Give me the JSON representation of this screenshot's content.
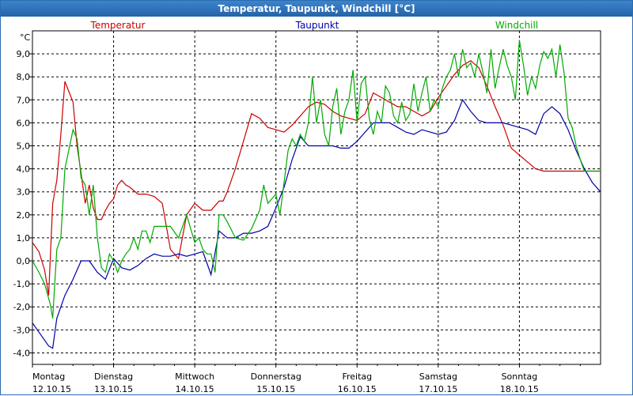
{
  "window": {
    "title": "Temperatur, Taupunkt, Windchill [°C]"
  },
  "chart_data": {
    "type": "line",
    "title": "Temperatur, Taupunkt, Windchill [°C]",
    "ylabel": "°C",
    "ylim": [
      -4.5,
      10.0
    ],
    "yticks": [
      -4,
      -3,
      -2,
      -1,
      0,
      1,
      2,
      3,
      4,
      5,
      6,
      7,
      8,
      9
    ],
    "ytick_labels": [
      "-4,0",
      "-3,0",
      "-2,0",
      "-1,0",
      "0,0",
      "1,0",
      "2,0",
      "3,0",
      "4,0",
      "5,0",
      "6,0",
      "7,0",
      "8,0",
      "9,0"
    ],
    "xlim": [
      0,
      7.0
    ],
    "x_label_days": [
      "Montag",
      "Dienstag",
      "Mittwoch",
      "Donnerstag",
      "Freitag",
      "Samstag",
      "Sonntag"
    ],
    "x_label_dates": [
      "12.10.15",
      "13.10.15",
      "14.10.15",
      "15.10.15",
      "16.10.15",
      "17.10.15",
      "18.10.15"
    ],
    "grid": true,
    "legend_position": "top",
    "series": [
      {
        "name": "Temperatur",
        "color": "#cc0000",
        "x": [
          0.0,
          0.08,
          0.15,
          0.2,
          0.25,
          0.3,
          0.35,
          0.4,
          0.5,
          0.55,
          0.6,
          0.65,
          0.7,
          0.75,
          0.8,
          0.85,
          0.9,
          0.95,
          1.0,
          1.05,
          1.1,
          1.15,
          1.2,
          1.3,
          1.4,
          1.5,
          1.6,
          1.7,
          1.8,
          1.9,
          2.0,
          2.1,
          2.2,
          2.25,
          2.3,
          2.35,
          2.4,
          2.5,
          2.6,
          2.7,
          2.8,
          2.9,
          3.0,
          3.1,
          3.2,
          3.3,
          3.4,
          3.5,
          3.6,
          3.7,
          3.8,
          3.9,
          4.0,
          4.1,
          4.2,
          4.3,
          4.4,
          4.5,
          4.6,
          4.7,
          4.8,
          4.9,
          5.0,
          5.1,
          5.2,
          5.3,
          5.4,
          5.5,
          5.6,
          5.7,
          5.8,
          5.9,
          6.0,
          6.1,
          6.2,
          6.3,
          6.4,
          6.5,
          6.6,
          6.7,
          6.8,
          6.9,
          7.0
        ],
        "values": [
          0.8,
          0.4,
          -0.4,
          -1.5,
          2.5,
          3.5,
          5.5,
          7.8,
          6.9,
          5.0,
          3.8,
          2.5,
          3.3,
          2.3,
          1.8,
          1.8,
          2.2,
          2.5,
          2.7,
          3.3,
          3.5,
          3.3,
          3.2,
          2.9,
          2.9,
          2.8,
          2.5,
          0.5,
          0.1,
          2.0,
          2.5,
          2.2,
          2.2,
          2.4,
          2.6,
          2.6,
          3.0,
          4.0,
          5.2,
          6.4,
          6.2,
          5.8,
          5.7,
          5.6,
          5.9,
          6.3,
          6.7,
          6.9,
          6.8,
          6.5,
          6.3,
          6.2,
          6.1,
          6.4,
          7.3,
          7.1,
          6.9,
          6.7,
          6.7,
          6.5,
          6.3,
          6.5,
          7.1,
          7.6,
          8.1,
          8.5,
          8.7,
          8.4,
          7.6,
          6.7,
          5.9,
          4.9,
          4.6,
          4.3,
          4.0,
          3.9,
          3.9,
          3.9,
          3.9,
          3.9,
          3.9,
          3.9,
          3.9
        ]
      },
      {
        "name": "Taupunkt",
        "color": "#0000aa",
        "x": [
          0.0,
          0.1,
          0.2,
          0.25,
          0.3,
          0.4,
          0.5,
          0.6,
          0.7,
          0.8,
          0.9,
          1.0,
          1.1,
          1.2,
          1.3,
          1.4,
          1.5,
          1.6,
          1.7,
          1.8,
          1.9,
          2.0,
          2.1,
          2.2,
          2.3,
          2.4,
          2.5,
          2.6,
          2.7,
          2.8,
          2.9,
          3.0,
          3.1,
          3.2,
          3.3,
          3.4,
          3.5,
          3.6,
          3.7,
          3.8,
          3.9,
          4.0,
          4.1,
          4.2,
          4.3,
          4.4,
          4.5,
          4.6,
          4.7,
          4.8,
          4.9,
          5.0,
          5.1,
          5.2,
          5.3,
          5.4,
          5.5,
          5.6,
          5.7,
          5.8,
          5.9,
          6.0,
          6.1,
          6.2,
          6.3,
          6.4,
          6.5,
          6.6,
          6.7,
          6.8,
          6.9,
          7.0
        ],
        "values": [
          -2.7,
          -3.2,
          -3.7,
          -3.8,
          -2.5,
          -1.5,
          -0.8,
          0.0,
          0.0,
          -0.5,
          -0.8,
          0.1,
          -0.3,
          -0.4,
          -0.2,
          0.1,
          0.3,
          0.2,
          0.2,
          0.3,
          0.2,
          0.3,
          0.4,
          -0.6,
          1.3,
          1.0,
          1.0,
          1.2,
          1.2,
          1.3,
          1.5,
          2.3,
          3.2,
          4.4,
          5.4,
          5.0,
          5.0,
          5.0,
          5.0,
          4.9,
          4.9,
          5.2,
          5.6,
          6.0,
          6.0,
          6.0,
          5.8,
          5.6,
          5.5,
          5.7,
          5.6,
          5.5,
          5.6,
          6.1,
          7.0,
          6.5,
          6.1,
          6.0,
          6.0,
          6.0,
          5.9,
          5.8,
          5.7,
          5.5,
          6.4,
          6.7,
          6.4,
          5.7,
          4.8,
          4.0,
          3.4,
          3.0
        ]
      },
      {
        "name": "Windchill",
        "color": "#00aa00",
        "x": [
          0.0,
          0.08,
          0.15,
          0.22,
          0.25,
          0.3,
          0.35,
          0.4,
          0.5,
          0.55,
          0.6,
          0.65,
          0.7,
          0.75,
          0.8,
          0.85,
          0.9,
          0.95,
          1.0,
          1.05,
          1.1,
          1.15,
          1.2,
          1.25,
          1.3,
          1.35,
          1.4,
          1.45,
          1.5,
          1.6,
          1.7,
          1.8,
          1.9,
          2.0,
          2.05,
          2.1,
          2.15,
          2.2,
          2.25,
          2.3,
          2.35,
          2.4,
          2.5,
          2.6,
          2.7,
          2.8,
          2.85,
          2.9,
          3.0,
          3.05,
          3.1,
          3.15,
          3.2,
          3.25,
          3.3,
          3.35,
          3.4,
          3.45,
          3.5,
          3.55,
          3.6,
          3.65,
          3.7,
          3.75,
          3.8,
          3.85,
          3.9,
          3.95,
          4.0,
          4.05,
          4.1,
          4.15,
          4.2,
          4.25,
          4.3,
          4.35,
          4.4,
          4.45,
          4.5,
          4.55,
          4.6,
          4.65,
          4.7,
          4.75,
          4.8,
          4.85,
          4.9,
          4.95,
          5.0,
          5.05,
          5.1,
          5.15,
          5.2,
          5.25,
          5.3,
          5.35,
          5.4,
          5.45,
          5.5,
          5.55,
          5.6,
          5.65,
          5.7,
          5.75,
          5.8,
          5.85,
          5.9,
          5.95,
          6.0,
          6.05,
          6.1,
          6.15,
          6.2,
          6.25,
          6.3,
          6.35,
          6.4,
          6.45,
          6.5,
          6.55,
          6.6,
          6.65,
          6.7,
          6.75,
          6.8,
          6.85,
          6.9,
          6.95,
          7.0
        ],
        "values": [
          0.0,
          -0.5,
          -1.0,
          -1.9,
          -2.5,
          0.5,
          1.0,
          4.0,
          5.7,
          5.3,
          3.6,
          3.3,
          2.0,
          3.3,
          1.0,
          -0.3,
          -0.5,
          0.3,
          0.0,
          -0.5,
          0.0,
          0.3,
          0.5,
          1.0,
          0.5,
          1.3,
          1.3,
          0.8,
          1.5,
          1.5,
          1.5,
          1.0,
          2.0,
          0.8,
          1.0,
          0.5,
          0.3,
          0.3,
          -0.5,
          2.0,
          2.0,
          1.7,
          1.0,
          0.9,
          1.4,
          2.2,
          3.3,
          2.5,
          2.9,
          2.0,
          3.4,
          4.8,
          5.3,
          5.0,
          5.5,
          5.2,
          6.0,
          8.0,
          6.0,
          7.0,
          5.5,
          5.0,
          6.7,
          7.5,
          5.5,
          6.5,
          7.0,
          8.3,
          6.0,
          7.7,
          8.0,
          6.2,
          5.5,
          6.5,
          6.0,
          7.6,
          7.3,
          6.3,
          6.0,
          6.9,
          6.1,
          6.4,
          7.7,
          6.5,
          7.3,
          8.0,
          6.5,
          7.0,
          6.7,
          7.5,
          8.0,
          8.3,
          9.0,
          8.0,
          9.2,
          8.4,
          8.6,
          8.0,
          9.0,
          8.2,
          7.3,
          9.2,
          7.5,
          8.4,
          9.2,
          8.5,
          8.0,
          7.0,
          9.6,
          8.5,
          7.2,
          8.0,
          7.5,
          8.5,
          9.1,
          8.8,
          9.2,
          8.0,
          9.4,
          8.2,
          6.2,
          5.8,
          5.0,
          4.4,
          3.9,
          3.9,
          3.9,
          3.9,
          3.9
        ]
      }
    ]
  }
}
